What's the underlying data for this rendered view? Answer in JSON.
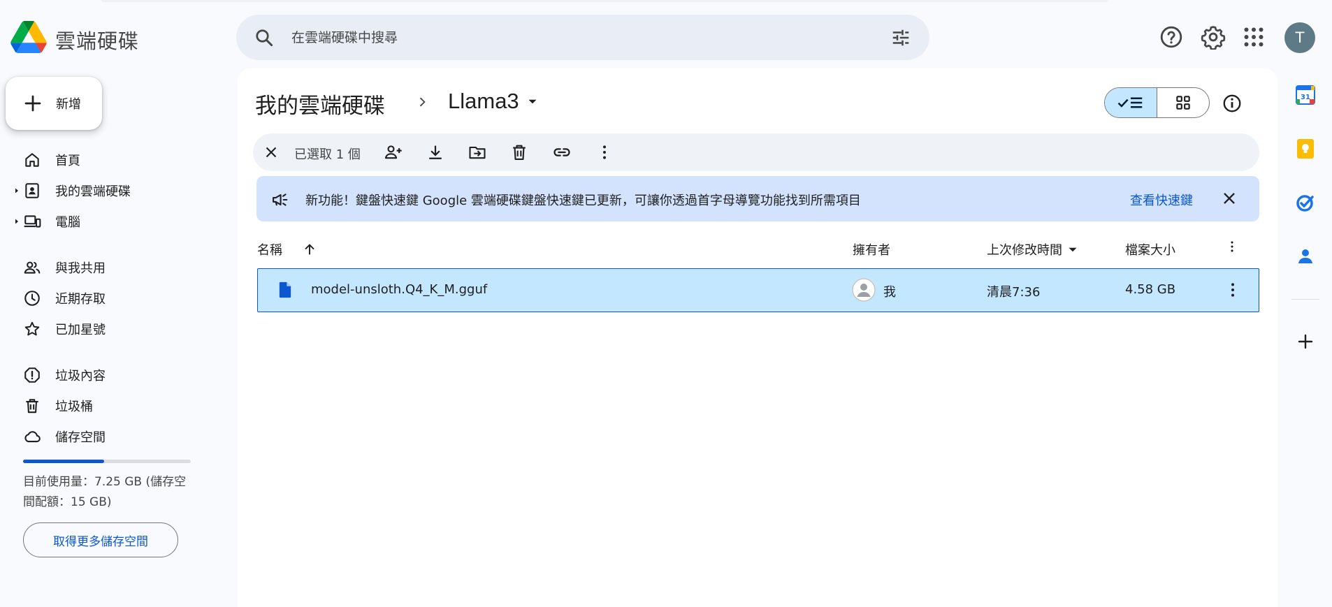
{
  "app": {
    "name": "雲端硬碟"
  },
  "search": {
    "placeholder": "在雲端硬碟中搜尋"
  },
  "header": {
    "avatar_initial": "T"
  },
  "sidebar": {
    "new_label": "新增",
    "items": [
      {
        "label": "首頁",
        "icon": "home-icon"
      },
      {
        "label": "我的雲端硬碟",
        "icon": "my-drive-icon"
      },
      {
        "label": "電腦",
        "icon": "computers-icon"
      },
      {
        "label": "與我共用",
        "icon": "shared-icon"
      },
      {
        "label": "近期存取",
        "icon": "recent-icon"
      },
      {
        "label": "已加星號",
        "icon": "star-icon"
      },
      {
        "label": "垃圾內容",
        "icon": "spam-icon"
      },
      {
        "label": "垃圾桶",
        "icon": "trash-icon"
      },
      {
        "label": "儲存空間",
        "icon": "cloud-icon"
      }
    ],
    "storage": {
      "usage_text": "目前使用量：7.25 GB (儲存空間配額：15 GB)",
      "used_fraction": 0.4833,
      "get_more_label": "取得更多儲存空間"
    }
  },
  "breadcrumb": {
    "root": "我的雲端硬碟",
    "current": "Llama3"
  },
  "selection": {
    "count_label": "已選取 1 個"
  },
  "banner": {
    "text": "新功能！鍵盤快速鍵 Google 雲端硬碟鍵盤快速鍵已更新，可讓你透過首字母導覽功能找到所需項目",
    "link_label": "查看快速鍵"
  },
  "table": {
    "columns": {
      "name": "名稱",
      "owner": "擁有者",
      "modified": "上次修改時間",
      "size": "檔案大小"
    },
    "rows": [
      {
        "name": "model-unsloth.Q4_K_M.gguf",
        "owner": "我",
        "modified": "清晨7:36",
        "size": "4.58 GB"
      }
    ]
  },
  "colors": {
    "accent": "#0b57d0",
    "selected_row": "#c2e7ff",
    "banner_bg": "#d3e3fd",
    "page_bg": "#f8fafd"
  }
}
